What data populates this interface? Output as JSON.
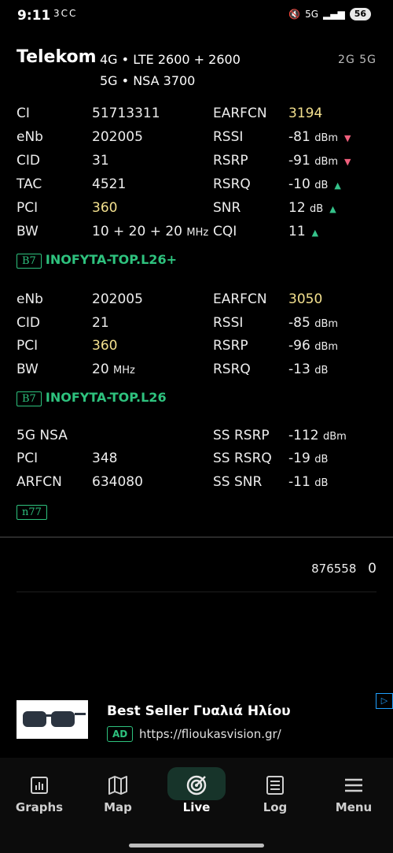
{
  "status": {
    "time": "9:11",
    "left_icons": "3CC",
    "right_icons": "5G",
    "battery": "56"
  },
  "header": {
    "operator": "Telekom",
    "bands_line1": "4G • LTE 2600 + 2600",
    "bands_line2": "5G • NSA 3700",
    "tech": "2G 5G"
  },
  "cell1": {
    "rows": [
      {
        "k": "CI",
        "v": "51713311",
        "k2": "EARFCN",
        "v2": "3194"
      },
      {
        "k": "eNb",
        "v": "202005",
        "k2": "RSSI",
        "v2": "-81",
        "u2": "dBm"
      },
      {
        "k": "CID",
        "v": "31",
        "k2": "RSRP",
        "v2": "-91",
        "u2": "dBm"
      },
      {
        "k": "TAC",
        "v": "4521",
        "k2": "RSRQ",
        "v2": "-10",
        "u2": "dB"
      },
      {
        "k": "PCI",
        "v": "360",
        "k2": "SNR",
        "v2": "12",
        "u2": "dB"
      },
      {
        "k": "BW",
        "v": "10 + 20 + 20",
        "u": "MHz",
        "k2": "CQI",
        "v2": "11"
      }
    ],
    "band": "B7",
    "name": "INOFYTA-TOP.L26+"
  },
  "cell2": {
    "rows": [
      {
        "k": "eNb",
        "v": "202005",
        "k2": "EARFCN",
        "v2": "3050"
      },
      {
        "k": "CID",
        "v": "21",
        "k2": "RSSI",
        "v2": "-85",
        "u2": "dBm"
      },
      {
        "k": "PCI",
        "v": "360",
        "k2": "RSRP",
        "v2": "-96",
        "u2": "dBm"
      },
      {
        "k": "BW",
        "v": "20",
        "u": "MHz",
        "k2": "RSRQ",
        "v2": "-13",
        "u2": "dB"
      }
    ],
    "band": "B7",
    "name": "INOFYTA-TOP.L26"
  },
  "nr": {
    "rows": [
      {
        "k": "5G NSA",
        "k2": "SS RSRP",
        "v2": "-112",
        "u2": "dBm"
      },
      {
        "k": "PCI",
        "v": "348",
        "k2": "SS RSRQ",
        "v2": "-19",
        "u2": "dB"
      },
      {
        "k": "ARFCN",
        "v": "634080",
        "k2": "SS SNR",
        "v2": "-11",
        "u2": "dB"
      }
    ],
    "band": "n77"
  },
  "counter": {
    "value": "876558",
    "extra": "0"
  },
  "ad": {
    "title": "Best Seller Γυαλιά Ηλίου",
    "badge": "AD",
    "url": "https://flioukasvision.gr/",
    "corner": "▷"
  },
  "nav": {
    "items": [
      "Graphs",
      "Map",
      "Live",
      "Log",
      "Menu"
    ]
  },
  "colors": {
    "accent_green": "#2ec27e",
    "highlight_yellow": "#f3e08e",
    "trend_up": "#35c28a",
    "trend_down": "#ef5f7c"
  }
}
